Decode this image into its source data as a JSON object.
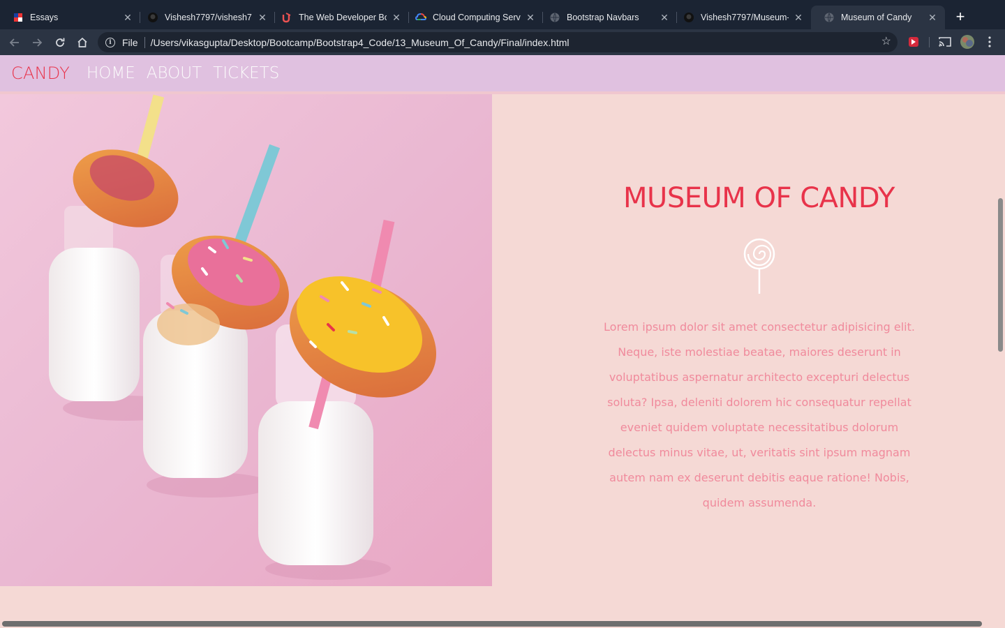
{
  "browser": {
    "tabs": [
      {
        "title": "Essays",
        "favicon": "flag-icon"
      },
      {
        "title": "Vishesh7797/vishesh7",
        "favicon": "github-icon"
      },
      {
        "title": "The Web Developer Bo",
        "favicon": "udemy-icon"
      },
      {
        "title": "Cloud Computing Serv",
        "favicon": "google-cloud-icon"
      },
      {
        "title": "Bootstrap Navbars",
        "favicon": "globe-icon"
      },
      {
        "title": "Vishesh7797/Museum-",
        "favicon": "github-icon"
      },
      {
        "title": "Museum of Candy",
        "favicon": "globe-icon",
        "active": true
      }
    ],
    "new_tab_label": "+",
    "address": {
      "scheme": "File",
      "url": "/Users/vikasgupta/Desktop/Bootcamp/Bootstrap4_Code/13_Museum_Of_Candy/Final/index.html"
    },
    "colors": {
      "tabstrip": "#1b2433",
      "toolbar": "#2b3443",
      "omnibox": "#1d2430"
    }
  },
  "site": {
    "nav": {
      "brand": "CANDY",
      "links": [
        "HOME",
        "ABOUT",
        "TICKETS"
      ]
    },
    "hero": {
      "image": "donuts-on-milk-bottles-photo",
      "title": "MUSEUM OF CANDY",
      "icon": "lollipop-icon",
      "text": "Lorem ipsum dolor sit amet consectetur adipisicing elit. Neque, iste molestiae beatae, maiores deserunt in voluptatibus aspernatur architecto excepturi delectus soluta? Ipsa, deleniti dolorem hic consequatur repellat eveniet quidem voluptate necessitatibus dolorum delectus minus vitae, ut, veritatis sint ipsum magnam autem nam ex deserunt debitis eaque ratione! Nobis, quidem assumenda."
    },
    "colors": {
      "nav_bg": "#e0c1e0",
      "brand": "#e8334a",
      "page_bg": "#f5d9d5",
      "body_text": "#f08a9c"
    }
  }
}
